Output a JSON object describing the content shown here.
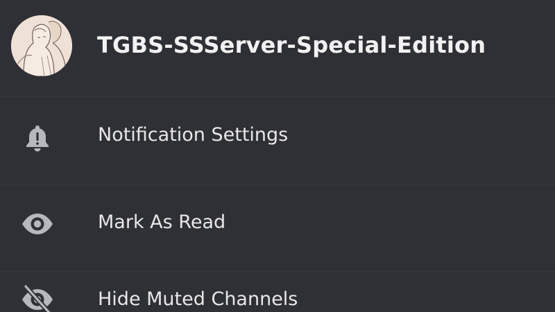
{
  "server": {
    "name": "TGBS-SSServer-Special-Edition"
  },
  "menu": {
    "items": [
      {
        "label": "Notification Settings",
        "icon": "bell-icon"
      },
      {
        "label": "Mark As Read",
        "icon": "eye-icon"
      },
      {
        "label": "Hide Muted Channels",
        "icon": "eye-slash-icon"
      }
    ]
  },
  "colors": {
    "background": "#2f3035",
    "text": "#ebebeb",
    "icon": "#b5b8bd",
    "divider": "#3a3b40"
  }
}
